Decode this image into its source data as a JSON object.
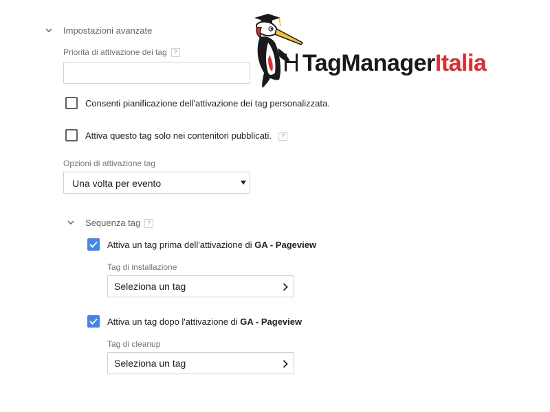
{
  "advanced": {
    "title": "Impostazioni avanzate",
    "priority_label": "Priorità di attivazione dei tag",
    "priority_value": "",
    "help": "?",
    "schedule_checkbox_label": "Consenti pianificazione dell'attivazione dei tag personalizzata.",
    "schedule_checked": false,
    "published_checkbox_label": "Attiva questo tag solo nei contenitori pubblicati.",
    "published_checked": false,
    "firing_options_label": "Opzioni di attivazione tag",
    "firing_options_value": "Una volta per evento"
  },
  "sequencing": {
    "title": "Sequenza tag",
    "setup": {
      "checkbox_prefix": "Attiva un tag prima dell'attivazione di ",
      "tag_name": "GA - Pageview",
      "checked": true,
      "field_label": "Tag di installazione",
      "field_value": "Seleziona un tag"
    },
    "cleanup": {
      "checkbox_prefix": "Attiva un tag dopo l'attivazione di ",
      "tag_name": "GA - Pageview",
      "checked": true,
      "field_label": "Tag di cleanup",
      "field_value": "Seleziona un tag"
    }
  },
  "logo": {
    "text_part1": "TagManager",
    "text_part2": "Italia",
    "color_dark": "#1a1a1a",
    "color_red": "#e8292b"
  },
  "colors": {
    "accent": "#4285f4"
  }
}
